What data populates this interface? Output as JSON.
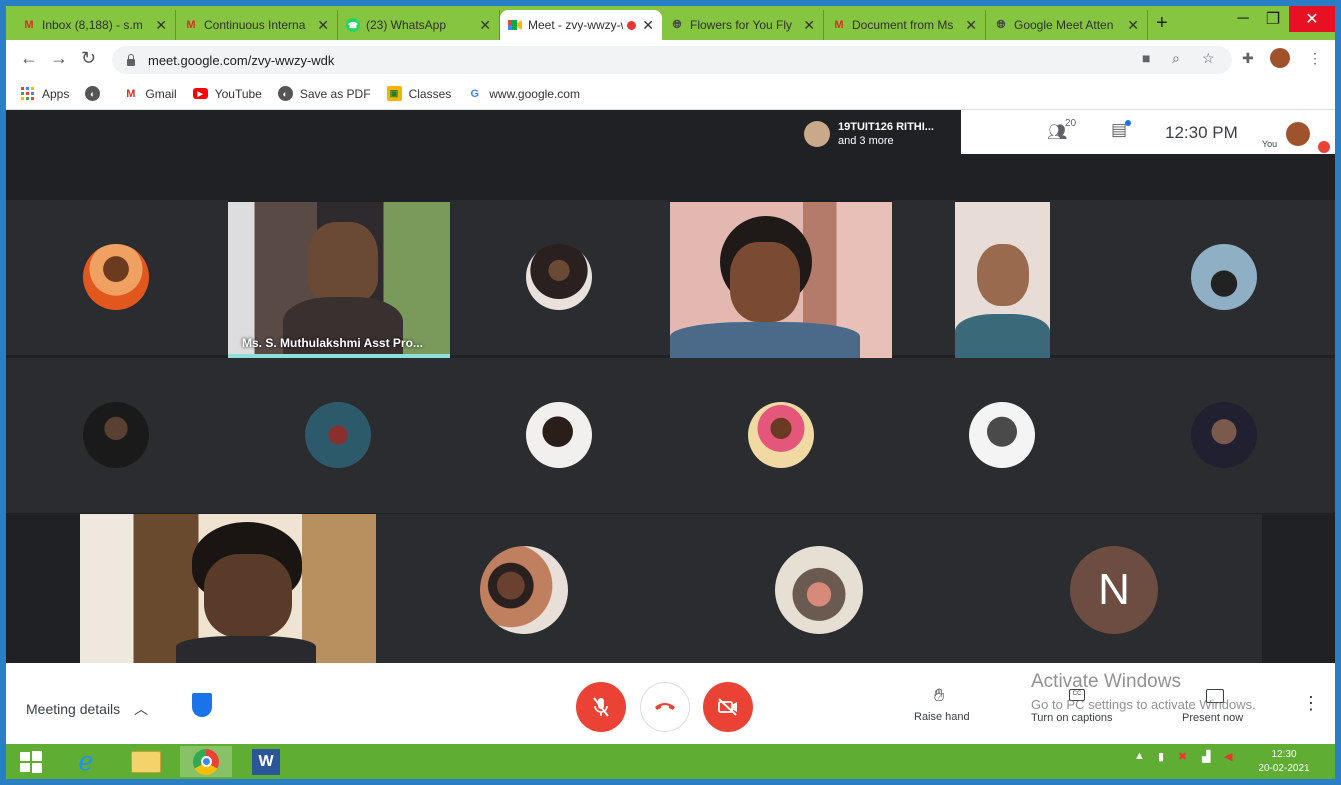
{
  "colors": {
    "accent_green": "#86c53f",
    "meet_bg": "#202124",
    "end_red": "#ea4335",
    "taskbar": "#5fae33"
  },
  "tabs": [
    {
      "title": "Inbox (8,188) - s.m",
      "icon": "gmail-icon",
      "active": false
    },
    {
      "title": "Continuous Interna",
      "icon": "gmail-icon",
      "active": false
    },
    {
      "title": "(23) WhatsApp",
      "icon": "whatsapp-icon",
      "active": false
    },
    {
      "title": "Meet - zvy-wwzy-wdk",
      "icon": "meet-icon",
      "active": true
    },
    {
      "title": "Flowers for You Fly",
      "icon": "globe-icon",
      "active": false
    },
    {
      "title": "Document from Ms",
      "icon": "gmail-icon",
      "active": false
    },
    {
      "title": "Google Meet Atten",
      "icon": "globe-icon",
      "active": false
    }
  ],
  "address": {
    "url": "meet.google.com/zvy-wwzy-wdk"
  },
  "bookmarks": [
    {
      "label": "Apps",
      "icon": "apps-grid-icon"
    },
    {
      "label": "",
      "icon": "globe-icon"
    },
    {
      "label": "Gmail",
      "icon": "gmail-icon"
    },
    {
      "label": "YouTube",
      "icon": "youtube-icon"
    },
    {
      "label": "Save as PDF",
      "icon": "globe-icon"
    },
    {
      "label": "Classes",
      "icon": "classroom-icon"
    },
    {
      "label": "www.google.com",
      "icon": "google-icon"
    }
  ],
  "meet": {
    "speaker_chip": {
      "line1": "19TUIT126 RITHI...",
      "line2": "and 3 more"
    },
    "participants_count": "20",
    "time": "12:30 PM",
    "you_label": "You",
    "presenter_label": "Ms. S. Muthulakshmi Asst Pro...",
    "letter_avatar": "N"
  },
  "controls": {
    "meeting_details": "Meeting details",
    "raise_hand": "Raise hand",
    "captions": "Turn on captions",
    "present": "Present now"
  },
  "watermark": {
    "line1": "Activate Windows",
    "line2": "Go to PC settings to activate Windows."
  },
  "taskbar": {
    "time": "12:30",
    "date": "20-02-2021"
  }
}
